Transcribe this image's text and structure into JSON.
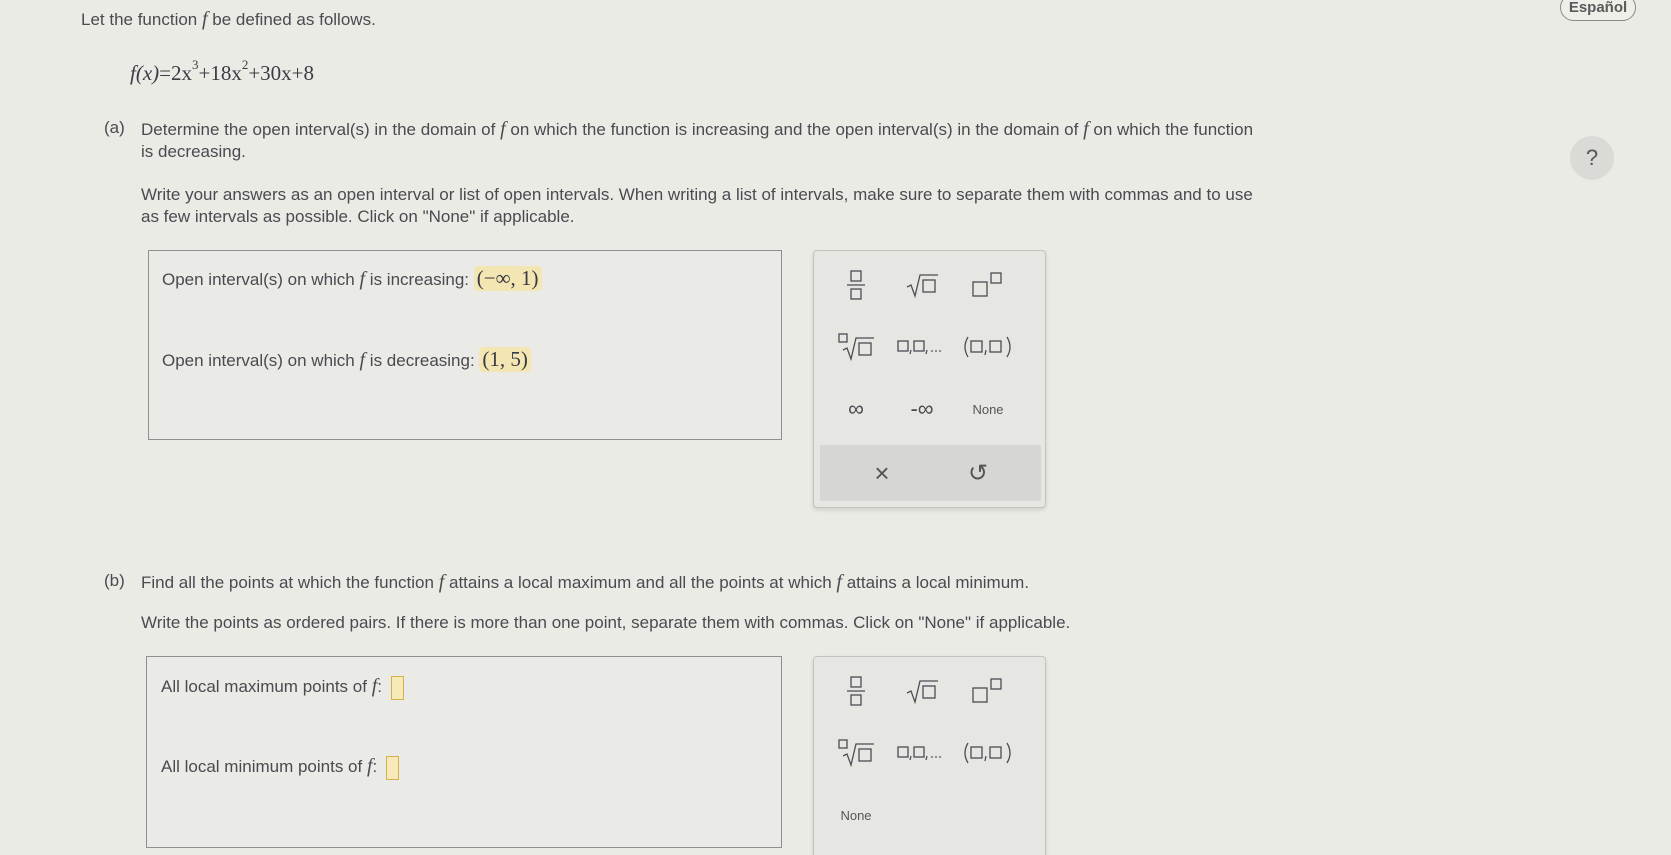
{
  "intro": {
    "text_before_f": "Let the function",
    "f_symbol": "f",
    "text_after_f": "be defined as follows."
  },
  "equation": {
    "lhs": "f(x)",
    "eq": "=",
    "t1": "2x",
    "t1_exp": "3",
    "t2": "+18x",
    "t2_exp": "2",
    "t3": "+30x+8"
  },
  "language_button": "Español",
  "help_button": "?",
  "part_a": {
    "marker": "(a)",
    "q_l1_a": "Determine the open interval(s) in the domain of",
    "q_l1_b": "on which the function is increasing and the open interval(s) in the domain of",
    "q_l1_c": "on which the function",
    "q_l2": "is decreasing.",
    "instr_l1": "Write your answers as an open interval or list of open intervals. When writing a list of intervals, make sure to separate them with commas and to use",
    "instr_l2": "as few intervals as possible. Click on \"None\" if applicable.",
    "increasing_label_a": "Open interval(s) on which",
    "increasing_label_b": "is increasing:",
    "increasing_value": "(−∞, 1)",
    "decreasing_label_a": "Open interval(s) on which",
    "decreasing_label_b": "is decreasing:",
    "decreasing_value": "(1, 5)"
  },
  "part_b": {
    "marker": "(b)",
    "q_a": "Find all the points at which the function",
    "q_b": "attains a local maximum and all the points at which",
    "q_c": "attains a local minimum.",
    "instr": "Write the points as ordered pairs. If there is more than one point, separate them with commas. Click on \"None\" if applicable.",
    "max_label": "All local maximum points of",
    "min_label": "All local minimum points of",
    "colon": ":"
  },
  "palette": {
    "infinity": "∞",
    "neg_infinity": "-∞",
    "none": "None",
    "clear": "×",
    "undo": "↺"
  },
  "colors": {
    "answer_highlight": "#f4e6b3",
    "empty_slot_fill": "#f8eab8",
    "empty_slot_border": "#d4b24a",
    "background": "#ebebe6"
  }
}
